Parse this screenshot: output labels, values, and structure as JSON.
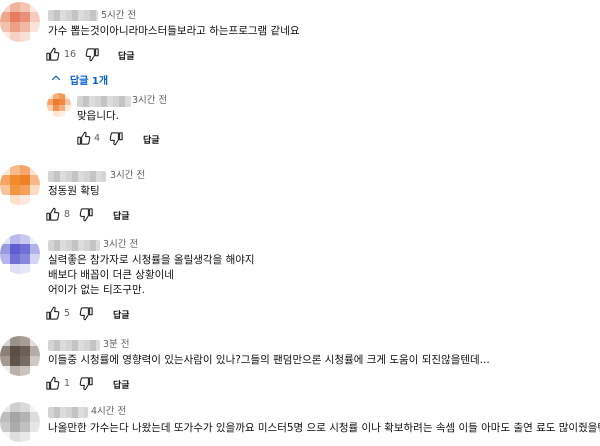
{
  "comments": [
    {
      "time": "5시간 전",
      "text": [
        "가수 뽑는것이아니라마스터들보라고 하는프로그램 같네요"
      ],
      "likes": "16",
      "reply_label": "답글",
      "replies_toggle": "답글 1개"
    },
    {
      "time": "3시간 전",
      "text": [
        "맞읍니다."
      ],
      "likes": "4",
      "reply_label": "답글"
    },
    {
      "time": "3시간 전",
      "text": [
        "정동원 확팅"
      ],
      "likes": "8",
      "reply_label": "답글"
    },
    {
      "time": "3시간 전",
      "text": [
        "실력좋은   참가자로   시청률을   올릴생각을  해야지",
        "배보다 배꼽이  더큰  상황이네",
        "어이가  없는 티조구만."
      ],
      "likes": "5",
      "reply_label": "답글"
    },
    {
      "time": "3분 전",
      "text": [
        "이들중 시청률에 영향력이 있는사람이 있나?그들의 팬덤만으론 시청률에 크게 도움이 되진않을텐데..."
      ],
      "likes": "1",
      "reply_label": "답글"
    },
    {
      "time": "4시간 전",
      "text": [
        "나올만한 가수는다 나왔는데 또가수가  있을까요 미스터5명 으로 시청률 이나 확보하려는 속셈 이들 아마도  출연 료도 많이줬을텐데요"
      ]
    }
  ],
  "icons": {
    "like": "thumbs-up-icon",
    "dislike": "thumbs-down-icon",
    "toggle": "chevron-up-icon"
  },
  "colors": {
    "link": "#065fd4",
    "muted": "#606060"
  }
}
